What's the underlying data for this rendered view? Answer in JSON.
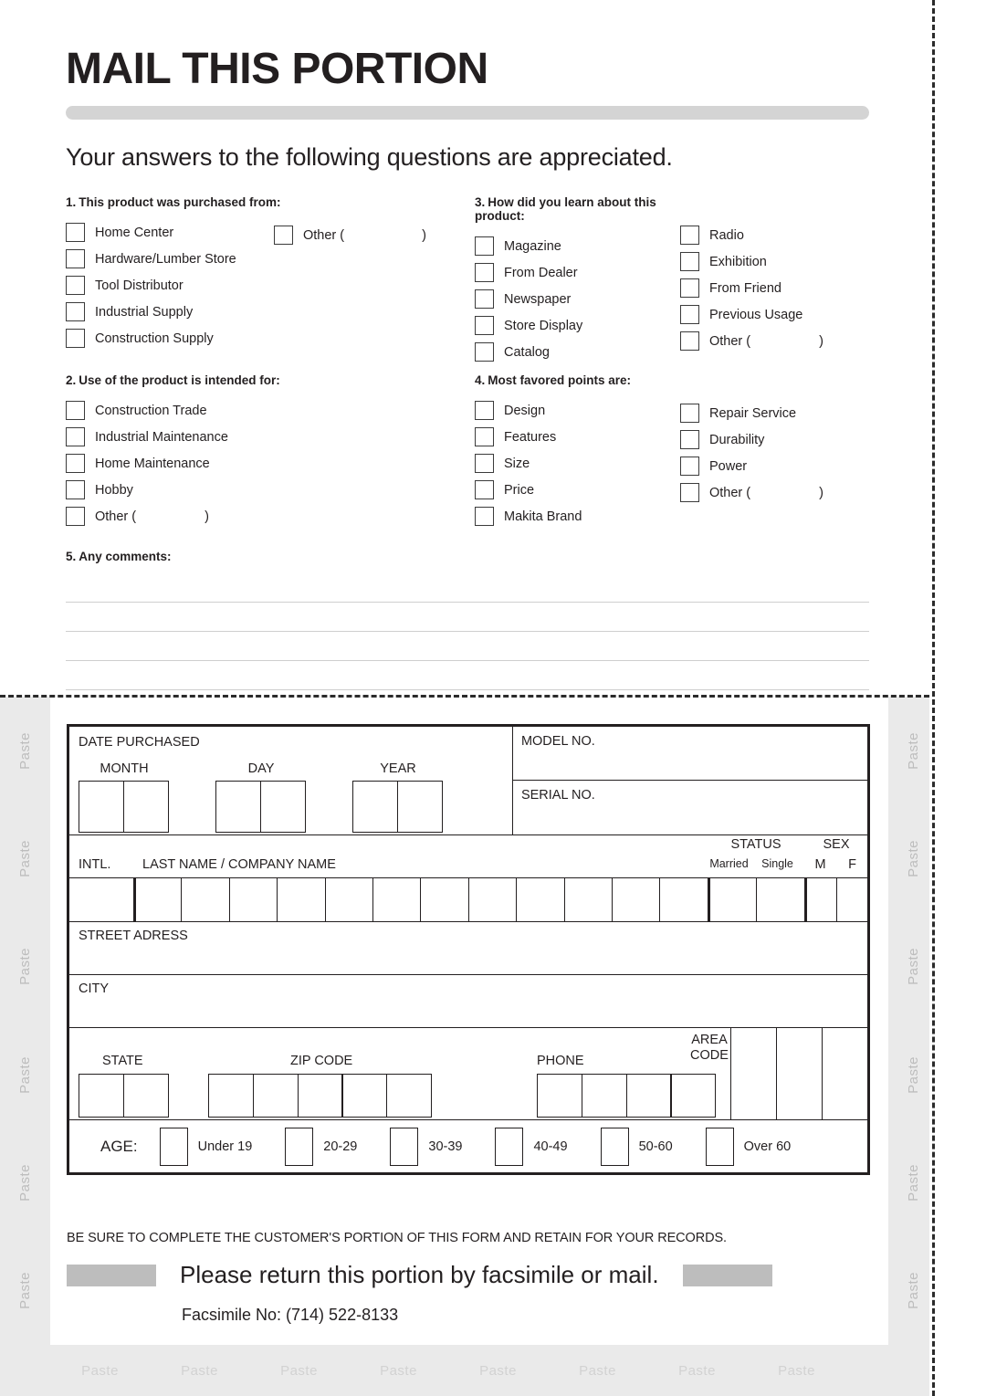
{
  "mail_portion": {
    "title": "MAIL THIS PORTION",
    "subtitle": "Your answers to the following questions are appreciated.",
    "questions": [
      {
        "num": "1.",
        "heading": "This product was purchased from:",
        "left_options": [
          "Home Center",
          "Hardware/Lumber Store",
          "Tool Distributor",
          "Industrial Supply",
          "Construction Supply"
        ],
        "right_options": [
          "Other ("
        ],
        "right_close": ")"
      },
      {
        "num": "2.",
        "heading": "Use of the product is intended for:",
        "left_options": [
          "Construction Trade",
          "Industrial Maintenance",
          "Home Maintenance",
          "Hobby",
          "Other ("
        ],
        "left_close": ")",
        "right_options": []
      },
      {
        "num": "3.",
        "heading": "How did you learn about this product:",
        "left_options": [
          "Magazine",
          "From Dealer",
          "Newspaper",
          "Store Display",
          "Catalog"
        ],
        "right_options": [
          "Radio",
          "Exhibition",
          "From Friend",
          "Previous Usage",
          "Other ("
        ],
        "right_close": ")"
      },
      {
        "num": "4.",
        "heading": "Most favored points are:",
        "left_options": [
          "Design",
          "Features",
          "Size",
          "Price",
          "Makita Brand"
        ],
        "right_options": [
          "Repair Service",
          "Durability",
          "Power",
          "Other ("
        ],
        "right_close": ")"
      }
    ],
    "comments": {
      "num": "5.",
      "heading": "Any comments:",
      "line_count": 4
    }
  },
  "customer_portion": {
    "paste_label": "Paste",
    "paste_side_count": 6,
    "paste_bottom_count": 8,
    "date_purchased": {
      "title": "DATE PURCHASED",
      "month_label": "MONTH",
      "day_label": "DAY",
      "year_label": "YEAR"
    },
    "model_label": "MODEL NO.",
    "serial_label": "SERIAL NO.",
    "name_row": {
      "intl_label": "INTL.",
      "name_label": "LAST NAME / COMPANY NAME",
      "status_label": "STATUS",
      "married_label": "Married",
      "single_label": "Single",
      "sex_label": "SEX",
      "male_label": "M",
      "female_label": "F",
      "name_cell_count": 12
    },
    "street_label": "STREET ADRESS",
    "city_label": "CITY",
    "state_label": "STATE",
    "zip_label": "ZIP CODE",
    "phone_label": "PHONE",
    "area_code_label_line1": "AREA",
    "area_code_label_line2": "CODE",
    "state_cell_count": 2,
    "zip_cell_count": 5,
    "phone_cell_count": 4,
    "area_cell_count": 3,
    "age": {
      "label": "AGE:",
      "ranges": [
        "Under 19",
        "20-29",
        "30-39",
        "40-49",
        "50-60",
        "Over 60"
      ]
    },
    "note": "BE SURE TO COMPLETE THE CUSTOMER'S PORTION OF THIS FORM AND RETAIN FOR YOUR RECORDS.",
    "return_text": "Please return this portion by facsimile or mail.",
    "fax_text": "Facsimile No: (714) 522-8133"
  },
  "colors": {
    "ink": "#231f20",
    "rule": "#d4d4d4",
    "panel": "#eaeaea",
    "paste_text": "#bdbdbd",
    "gray_bar": "#bdbdbd"
  }
}
